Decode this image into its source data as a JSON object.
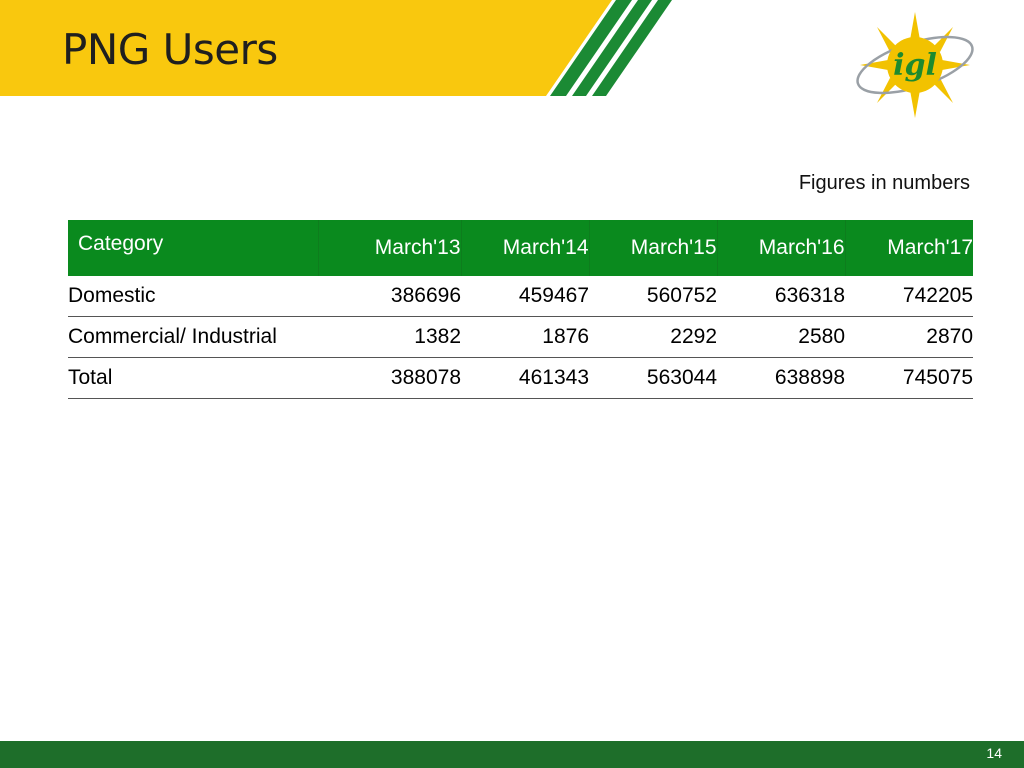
{
  "slide": {
    "title": "PNG Users",
    "note": "Figures in numbers",
    "page_number": "14"
  },
  "logo": {
    "text": "igl",
    "colors": {
      "sun": "#f2c200",
      "text": "#1d8a2e",
      "orbit": "#9aa0a6"
    }
  },
  "colors": {
    "title_band": "#f9c80e",
    "stripes": "#1b8a34",
    "table_header": "#0a8a1e",
    "footer": "#1e6e2a"
  },
  "table": {
    "headers": [
      "Category",
      "March'13",
      "March'14",
      "March'15",
      "March'16",
      "March'17"
    ],
    "rows": [
      [
        "Domestic",
        "386696",
        "459467",
        "560752",
        "636318",
        "742205"
      ],
      [
        "Commercial/ Industrial",
        "1382",
        "1876",
        "2292",
        "2580",
        "2870"
      ],
      [
        "Total",
        "388078",
        "461343",
        "563044",
        "638898",
        "745075"
      ]
    ]
  }
}
